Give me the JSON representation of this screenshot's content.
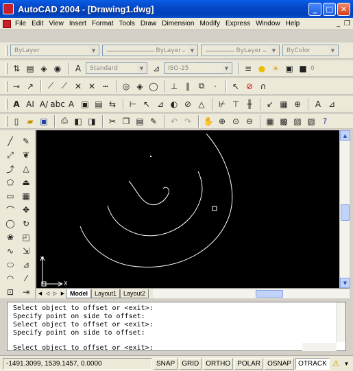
{
  "window": {
    "title": "AutoCAD 2004 - [Drawing1.dwg]",
    "minimize": "_",
    "maximize": "□",
    "close": "✕"
  },
  "menu": {
    "items": [
      "File",
      "Edit",
      "View",
      "Insert",
      "Format",
      "Tools",
      "Draw",
      "Dimension",
      "Modify",
      "Express",
      "Window",
      "Help"
    ],
    "doc_minimize": "_",
    "doc_restore": "❐"
  },
  "properties": {
    "color": "ByLayer",
    "linetype": "ByLayer",
    "lineweight": "ByLayer",
    "plotstyle": "ByColor"
  },
  "styles": {
    "text_style": "Standard",
    "dim_style": "ISO-25",
    "layer": "0"
  },
  "command": {
    "history": [
      "Select object to offset or <exit>:",
      "Specify point on side to offset:",
      "Select object to offset or <exit>:",
      "Specify point on side to offset:"
    ],
    "prompt": "Select object to offset or <exit>:"
  },
  "layout_tabs": {
    "model": "Model",
    "layout1": "Layout1",
    "layout2": "Layout2"
  },
  "status": {
    "coordinates": "-1491.3099, 1539.1457, 0.0000",
    "buttons": [
      {
        "label": "SNAP",
        "on": false
      },
      {
        "label": "GRID",
        "on": false
      },
      {
        "label": "ORTHO",
        "on": false
      },
      {
        "label": "POLAR",
        "on": false
      },
      {
        "label": "OSNAP",
        "on": false
      },
      {
        "label": "OTRACK",
        "on": true
      }
    ]
  },
  "ucs": {
    "x_label": "X",
    "y_label": "Y"
  },
  "colors": {
    "canvas": "#000000",
    "titlebar": "#0548c8",
    "linework": "#ffffff"
  }
}
